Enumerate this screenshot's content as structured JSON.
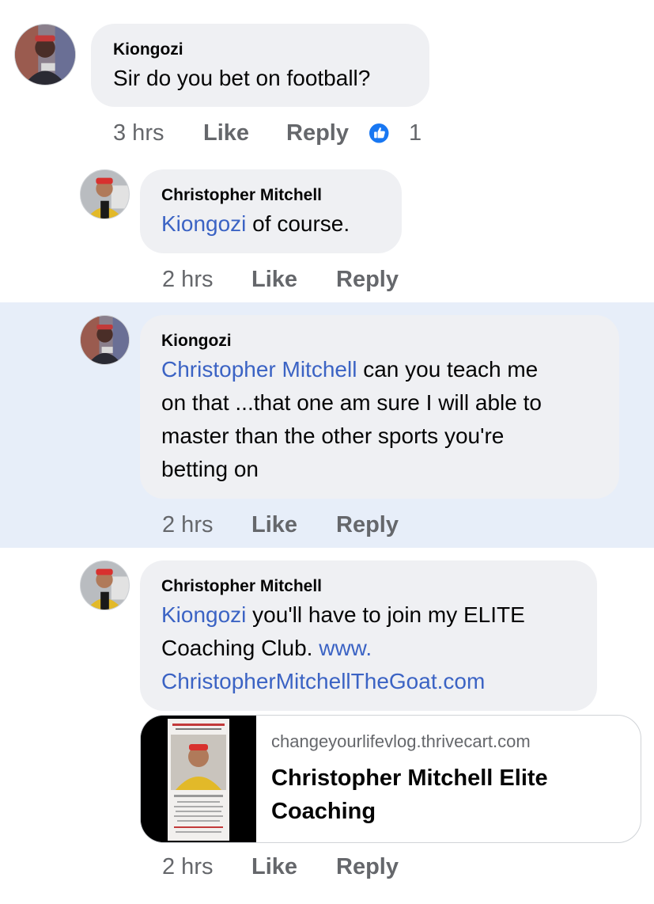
{
  "comments": [
    {
      "author": "Kiongozi",
      "text": "Sir do you bet on football?",
      "time": "3 hrs",
      "like_label": "Like",
      "reply_label": "Reply",
      "reaction_count": "1"
    },
    {
      "author": "Christopher Mitchell",
      "mention": "Kiongozi",
      "text": " of course.",
      "time": "2 hrs",
      "like_label": "Like",
      "reply_label": "Reply"
    },
    {
      "author": "Kiongozi",
      "mention": "Christopher Mitchell",
      "line1": " can you teach  me",
      "line2": "on that ...that one am sure I will able to",
      "line3": "master than the other sports you're",
      "line4": "betting on",
      "time": "2 hrs",
      "like_label": "Like",
      "reply_label": "Reply"
    },
    {
      "author": "Christopher Mitchell",
      "mention": "Kiongozi",
      "line1": " you'll have to join my ELITE",
      "line2_text": "Coaching Club. ",
      "line2_link": "www.",
      "line3_link": "ChristopherMitchellTheGoat.com",
      "time": "2 hrs",
      "like_label": "Like",
      "reply_label": "Reply",
      "preview": {
        "domain": "changeyourlifevlog.thrivecart.com",
        "title": "Christopher Mitchell Elite Coaching"
      }
    }
  ],
  "colors": {
    "bubble": "#eff0f3",
    "highlight": "#e7eef9",
    "link": "#3b63c4",
    "meta": "#65676b",
    "like_blue": "#1877f2"
  }
}
